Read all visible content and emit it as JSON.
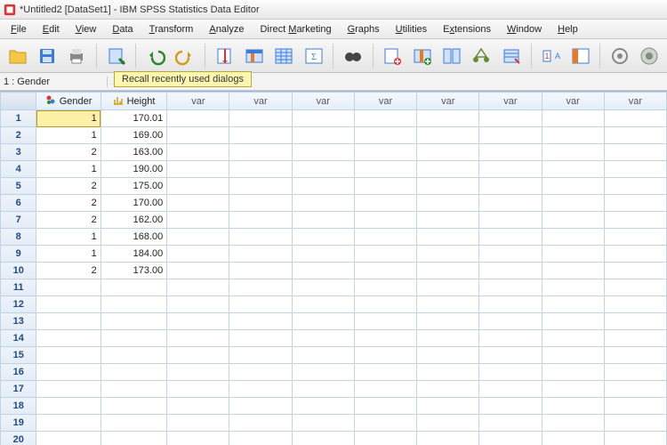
{
  "titlebar": {
    "title": "*Untitled2 [DataSet1] - IBM SPSS Statistics Data Editor"
  },
  "menubar": {
    "items": [
      {
        "label": "File",
        "underline": 0
      },
      {
        "label": "Edit",
        "underline": 0
      },
      {
        "label": "View",
        "underline": 0
      },
      {
        "label": "Data",
        "underline": 0
      },
      {
        "label": "Transform",
        "underline": 0
      },
      {
        "label": "Analyze",
        "underline": 0
      },
      {
        "label": "Direct Marketing",
        "underline": 7
      },
      {
        "label": "Graphs",
        "underline": 0
      },
      {
        "label": "Utilities",
        "underline": 0
      },
      {
        "label": "Extensions",
        "underline": 1
      },
      {
        "label": "Window",
        "underline": 0
      },
      {
        "label": "Help",
        "underline": 0
      }
    ]
  },
  "toolbar": {
    "tooltip": "Recall recently used dialogs",
    "buttons": [
      {
        "name": "open-file-button",
        "icon": "folder"
      },
      {
        "name": "save-button",
        "icon": "disk"
      },
      {
        "name": "print-button",
        "icon": "printer"
      },
      {
        "name": "recall-dialogs-button",
        "icon": "recall"
      },
      {
        "name": "undo-button",
        "icon": "undo"
      },
      {
        "name": "redo-button",
        "icon": "redo"
      },
      {
        "name": "goto-case-button",
        "icon": "gotocase"
      },
      {
        "name": "goto-variable-button",
        "icon": "gotovar"
      },
      {
        "name": "variables-button",
        "icon": "variables"
      },
      {
        "name": "run-descriptives-button",
        "icon": "descriptives"
      },
      {
        "name": "find-button",
        "icon": "binoculars"
      },
      {
        "name": "insert-cases-button",
        "icon": "insertcase"
      },
      {
        "name": "insert-variable-button",
        "icon": "insertvar"
      },
      {
        "name": "split-file-button",
        "icon": "split"
      },
      {
        "name": "weight-cases-button",
        "icon": "weight"
      },
      {
        "name": "select-cases-button",
        "icon": "select"
      },
      {
        "name": "value-labels-button",
        "icon": "valuelabels"
      },
      {
        "name": "use-variable-sets-button",
        "icon": "varsets"
      },
      {
        "name": "show-all-variables-button",
        "icon": "showall"
      },
      {
        "name": "spell-check-button",
        "icon": "spellcheck"
      }
    ]
  },
  "infobar": {
    "label": "1 : Gender",
    "value": "1"
  },
  "columns": {
    "defined": [
      "Gender",
      "Height"
    ],
    "placeholder": "var",
    "placeholder_count": 8
  },
  "rows": {
    "total": 20,
    "data": [
      {
        "Gender": "1",
        "Height": "170.01"
      },
      {
        "Gender": "1",
        "Height": "169.00"
      },
      {
        "Gender": "2",
        "Height": "163.00"
      },
      {
        "Gender": "1",
        "Height": "190.00"
      },
      {
        "Gender": "2",
        "Height": "175.00"
      },
      {
        "Gender": "2",
        "Height": "170.00"
      },
      {
        "Gender": "2",
        "Height": "162.00"
      },
      {
        "Gender": "1",
        "Height": "168.00"
      },
      {
        "Gender": "1",
        "Height": "184.00"
      },
      {
        "Gender": "2",
        "Height": "173.00"
      }
    ]
  },
  "selection": {
    "row": 0,
    "col": "Gender"
  },
  "icons": {
    "gender_hdr": "nominal-icon",
    "height_hdr": "scale-icon"
  }
}
